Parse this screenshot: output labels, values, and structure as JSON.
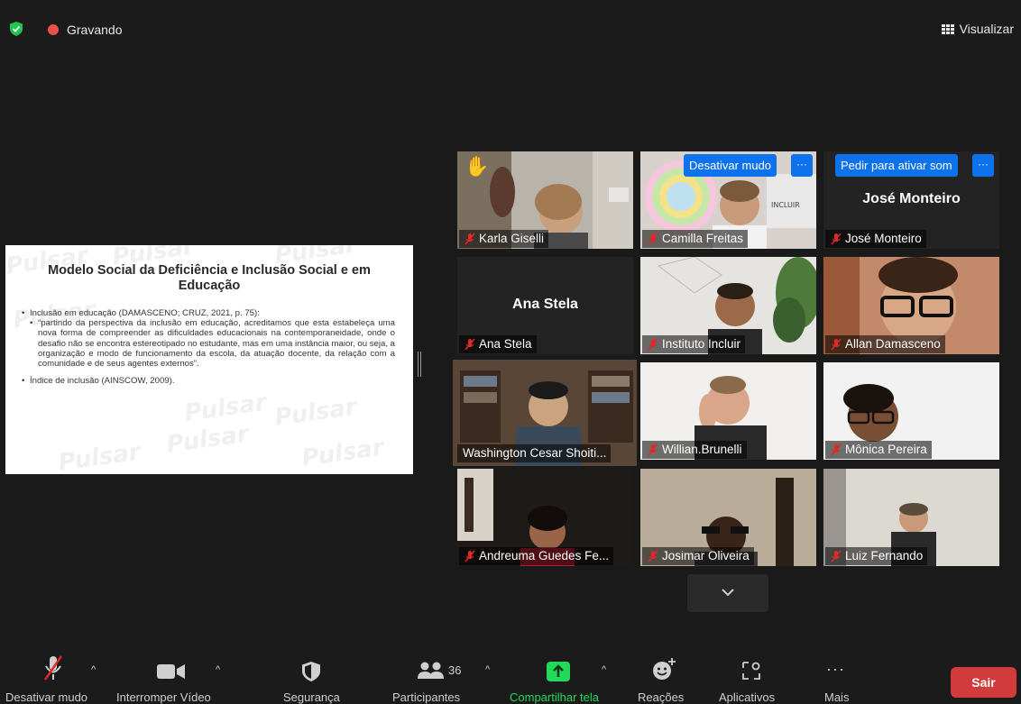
{
  "topbar": {
    "recording_label": "Gravando",
    "view_label": "Visualizar"
  },
  "slide": {
    "title": "Modelo Social da Deficiência e Inclusão Social e em Educação",
    "bullet1": "Inclusão em educação (DAMASCENO; CRUZ, 2021, p. 75):",
    "quote": "“partindo da perspectiva da inclusão em educação, acreditamos que esta estabeleça uma nova forma de compreender as dificuldades educacionais na contemporaneidade, onde o desafio não se encontra estereotipado no estudante, mas em uma instância maior, ou seja, a organização e modo de funcionamento da escola, da atuação docente, da relação com a comunidade e de seus agentes externos”.",
    "bullet2": "Índice de inclusão (AINSCOW, 2009).",
    "watermark": "Pulsar"
  },
  "participants": [
    {
      "name": "Karla Giselli",
      "muted": true,
      "hand_raised": true
    },
    {
      "name": "Camilla Freitas",
      "muted": true,
      "hover_action": "Desativar mudo"
    },
    {
      "name": "José Monteiro",
      "muted": true,
      "video_off": true,
      "hover_action": "Pedir para ativar som"
    },
    {
      "name": "Ana Stela",
      "muted": true,
      "video_off": true
    },
    {
      "name": "Instituto Incluir",
      "muted": true
    },
    {
      "name": "Allan Damasceno",
      "muted": true
    },
    {
      "name": "Washington Cesar Shoiti...",
      "muted": false,
      "active_speaker": true
    },
    {
      "name": "Willian.Brunelli",
      "muted": true
    },
    {
      "name": "Mônica Pereira",
      "muted": true
    },
    {
      "name": "Andreuma Guedes Fe...",
      "muted": true
    },
    {
      "name": "Josimar Oliveira",
      "muted": true
    },
    {
      "name": "Luiz Fernando",
      "muted": true
    }
  ],
  "tiles_misc": {
    "more_label": "···"
  },
  "toolbar": {
    "mute_label": "Desativar mudo",
    "video_label": "Interromper Vídeo",
    "security_label": "Segurança",
    "participants_label": "Participantes",
    "participants_count": "36",
    "share_label": "Compartilhar tela",
    "reactions_label": "Reações",
    "apps_label": "Aplicativos",
    "more_label": "Mais",
    "leave_label": "Sair"
  },
  "colors": {
    "background": "#1a1a1a",
    "accent_blue": "#0e72ed",
    "share_green": "#23d959",
    "leave_red": "#d13b3b",
    "active_outline": "#c8e86a",
    "muted_red": "#e02828"
  },
  "icons": [
    "shield-icon",
    "record-icon",
    "grid-view-icon",
    "mic-muted-icon",
    "raised-hand-icon",
    "video-icon",
    "security-icon",
    "participants-icon",
    "share-arrow-icon",
    "reaction-icon",
    "apps-icon",
    "more-icon",
    "chevron-down-icon"
  ]
}
